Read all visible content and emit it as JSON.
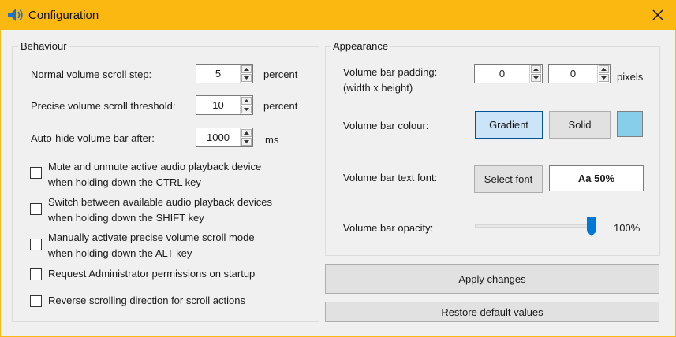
{
  "window": {
    "title": "Configuration",
    "app_icon": "speaker-icon",
    "close_icon": "close-icon",
    "accent_color": "#fbb811"
  },
  "behaviour": {
    "group_label": "Behaviour",
    "scroll_step": {
      "label": "Normal volume scroll step:",
      "value": "5",
      "unit": "percent"
    },
    "precise_threshold": {
      "label": "Precise volume scroll threshold:",
      "value": "10",
      "unit": "percent"
    },
    "autohide": {
      "label": "Auto-hide volume bar after:",
      "value": "1000",
      "unit": "ms"
    },
    "checkboxes": [
      {
        "line1": "Mute and unmute active audio playback device",
        "line2": "when holding down the CTRL key",
        "checked": false
      },
      {
        "line1": "Switch between available audio playback devices",
        "line2": "when holding down the SHIFT key",
        "checked": false
      },
      {
        "line1": "Manually activate precise volume scroll mode",
        "line2": "when holding down the ALT key",
        "checked": false
      },
      {
        "line1": "Request Administrator permissions on startup",
        "line2": "",
        "checked": false
      },
      {
        "line1": "Reverse scrolling direction for scroll actions",
        "line2": "",
        "checked": false
      }
    ]
  },
  "appearance": {
    "group_label": "Appearance",
    "padding": {
      "label_line1": "Volume bar padding:",
      "label_line2": "(width x height)",
      "width": "0",
      "height": "0",
      "unit": "pixels"
    },
    "colour": {
      "label": "Volume bar colour:",
      "gradient_label": "Gradient",
      "solid_label": "Solid",
      "selected": "Gradient",
      "swatch_color": "#87ceeb"
    },
    "font": {
      "label": "Volume bar text font:",
      "select_label": "Select font",
      "preview": "Aa 50%"
    },
    "opacity": {
      "label": "Volume bar opacity:",
      "value_text": "100%",
      "value": 1.0
    }
  },
  "actions": {
    "apply_label": "Apply changes",
    "restore_label": "Restore default values"
  }
}
